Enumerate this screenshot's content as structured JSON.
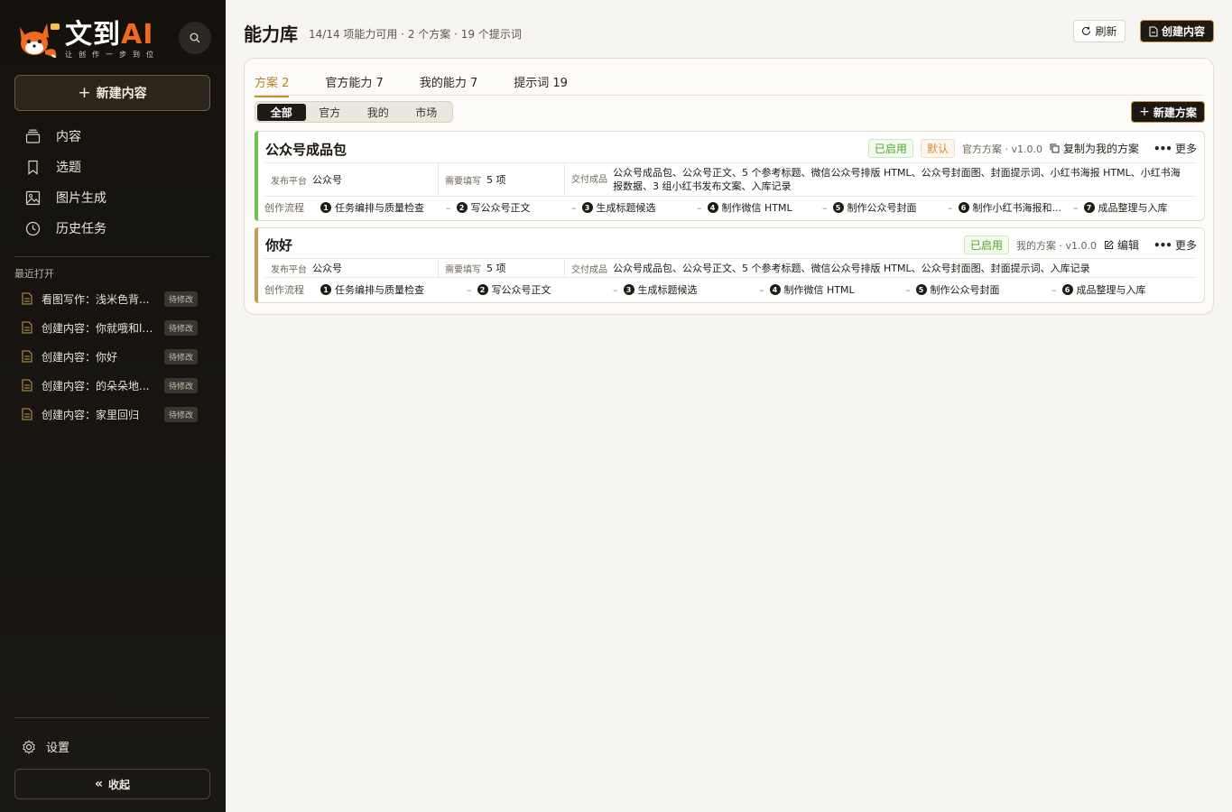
{
  "brand": {
    "title": "文到",
    "title_ai": "AI",
    "subtitle": "让创作一步到位"
  },
  "sidebar": {
    "new_label": "新建内容",
    "nav": [
      {
        "label": "内容",
        "icon": "layers-icon"
      },
      {
        "label": "选题",
        "icon": "bookmark-icon"
      },
      {
        "label": "图片生成",
        "icon": "image-icon"
      },
      {
        "label": "历史任务",
        "icon": "clock-icon"
      }
    ],
    "recent_title": "最近打开",
    "recent": [
      {
        "label": "看图写作：浅米色背...",
        "badge": "待修改"
      },
      {
        "label": "创建内容：你就哦和ll...",
        "badge": "待修改"
      },
      {
        "label": "创建内容：你好",
        "badge": "待修改"
      },
      {
        "label": "创建内容：的朵朵地...",
        "badge": "待修改"
      },
      {
        "label": "创建内容：家里回归",
        "badge": "待修改"
      }
    ],
    "settings_label": "设置",
    "collapse_label": "收起"
  },
  "header": {
    "title": "能力库",
    "stats": "14/14 项能力可用 · 2 个方案 · 19 个提示词",
    "refresh_label": "刷新",
    "create_label": "创建内容"
  },
  "tabs": [
    {
      "label": "方案 2",
      "active": true
    },
    {
      "label": "官方能力 7",
      "active": false
    },
    {
      "label": "我的能力 7",
      "active": false
    },
    {
      "label": "提示词 19",
      "active": false
    }
  ],
  "filters": [
    {
      "label": "全部",
      "active": true
    },
    {
      "label": "官方",
      "active": false
    },
    {
      "label": "我的",
      "active": false
    },
    {
      "label": "市场",
      "active": false
    }
  ],
  "new_plan_label": "新建方案",
  "labels": {
    "platform": "发布平台",
    "required": "需要填写",
    "deliverables": "交付成品",
    "flow": "创作流程",
    "more": "更多"
  },
  "plans": [
    {
      "title": "公众号成品包",
      "status": "已启用",
      "default_tag": "默认",
      "meta": "官方方案 · v1.0.0",
      "action": "复制为我的方案",
      "accent": "#6cc24a",
      "platform": "公众号",
      "required": "5 项",
      "deliverables": "公众号成品包、公众号正文、5 个参考标题、微信公众号排版 HTML、公众号封面图、封面提示词、小红书海报 HTML、小红书海报数据、3 组小红书发布文案、入库记录",
      "steps": [
        "任务编排与质量检查",
        "写公众号正文",
        "生成标题候选",
        "制作微信 HTML",
        "制作公众号封面",
        "制作小红书海报和...",
        "成品整理与入库"
      ]
    },
    {
      "title": "你好",
      "status": "已启用",
      "default_tag": "",
      "meta": "我的方案 · v1.0.0",
      "action": "编辑",
      "accent": "#c49a5a",
      "platform": "公众号",
      "required": "5 项",
      "deliverables": "公众号成品包、公众号正文、5 个参考标题、微信公众号排版 HTML、公众号封面图、封面提示词、入库记录",
      "steps": [
        "任务编排与质量检查",
        "写公众号正文",
        "生成标题候选",
        "制作微信 HTML",
        "制作公众号封面",
        "成品整理与入库"
      ]
    }
  ]
}
